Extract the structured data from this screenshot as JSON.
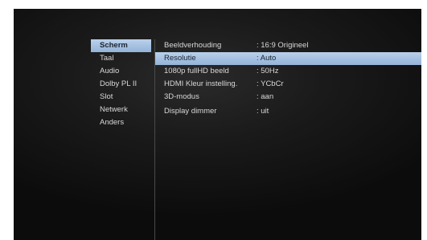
{
  "menu": {
    "items": [
      {
        "label": "Scherm"
      },
      {
        "label": "Taal"
      },
      {
        "label": "Audio"
      },
      {
        "label": "Dolby PL II"
      },
      {
        "label": "Slot"
      },
      {
        "label": "Netwerk"
      },
      {
        "label": "Anders"
      }
    ],
    "active": "Scherm"
  },
  "settings": [
    {
      "label": "Beeldverhouding",
      "value": ": 16:9 Origineel"
    },
    {
      "label": "Resolutie",
      "value": ": Auto"
    },
    {
      "label": "1080p fullHD beeld",
      "value": ": 50Hz"
    },
    {
      "label": "HDMI Kleur instelling.",
      "value": ": YCbCr"
    },
    {
      "label": "3D-modus",
      "value": ": aan"
    },
    {
      "label": "Display dimmer",
      "value": ": uit"
    }
  ],
  "selected_setting": "Resolutie",
  "colors": {
    "highlight": "#a9c3e2",
    "text": "#d8d8d8",
    "background": "#1a1a1a"
  }
}
